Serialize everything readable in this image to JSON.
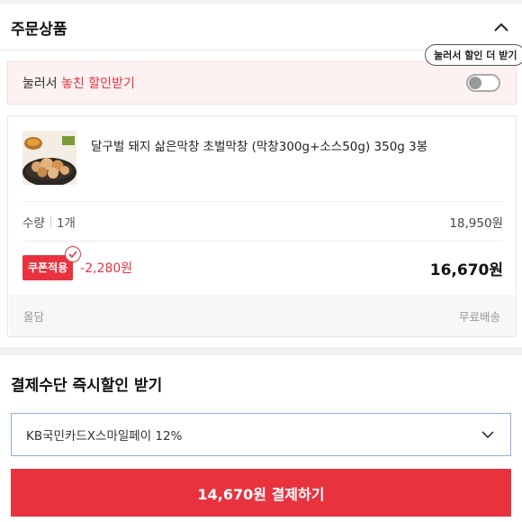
{
  "order": {
    "title": "주문상품",
    "collapse_icon": "chevron-up-icon"
  },
  "discount": {
    "prefix": "눌러서 ",
    "highlight": "놓친 할인받기",
    "toggle_on": false,
    "tooltip": "눌러서 할인 더 받기"
  },
  "product": {
    "name": "달구벌 돼지 삶은막창 초벌막창 (막창300g+소스50g) 350g 3봉",
    "qty_label": "수량",
    "qty_value": "1개",
    "original_price": "18,950원",
    "coupon_label": "쿠폰적용",
    "discount_amount": "-2,280원",
    "final_price": "16,670원",
    "seller": "올담",
    "shipping": "무료배송"
  },
  "payment": {
    "title": "결제수단 즉시할인 받기",
    "selected_method": "KB국민카드X스마일페이 12%",
    "pay_button": "14,670원 결제하기"
  },
  "colors": {
    "accent_red": "#e8333f",
    "select_border": "#8db2e0"
  }
}
